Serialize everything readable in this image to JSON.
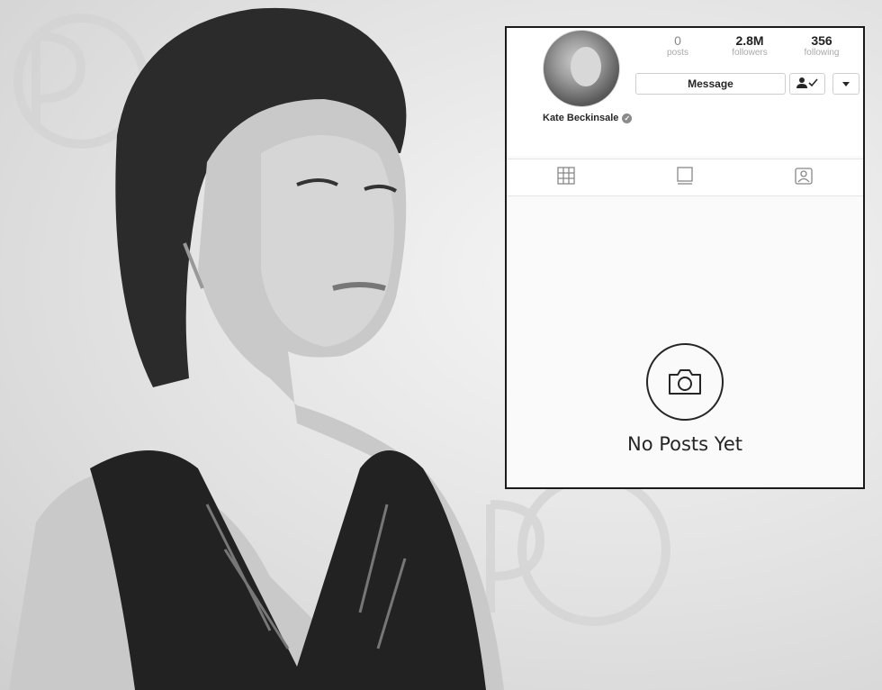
{
  "profile": {
    "username": "Kate Beckinsale",
    "stats": [
      {
        "value": "0",
        "label": "posts"
      },
      {
        "value": "2.8M",
        "label": "followers"
      },
      {
        "value": "356",
        "label": "following"
      }
    ],
    "message_label": "Message"
  },
  "tabs": [
    {
      "icon": "grid-icon"
    },
    {
      "icon": "list-icon"
    },
    {
      "icon": "tagged-icon"
    }
  ],
  "empty_state": {
    "icon": "camera-icon",
    "text": "No Posts Yet"
  },
  "icons": {
    "follow": "person-check-icon",
    "more": "chevron-down-icon",
    "verified": "verified-badge-icon"
  }
}
